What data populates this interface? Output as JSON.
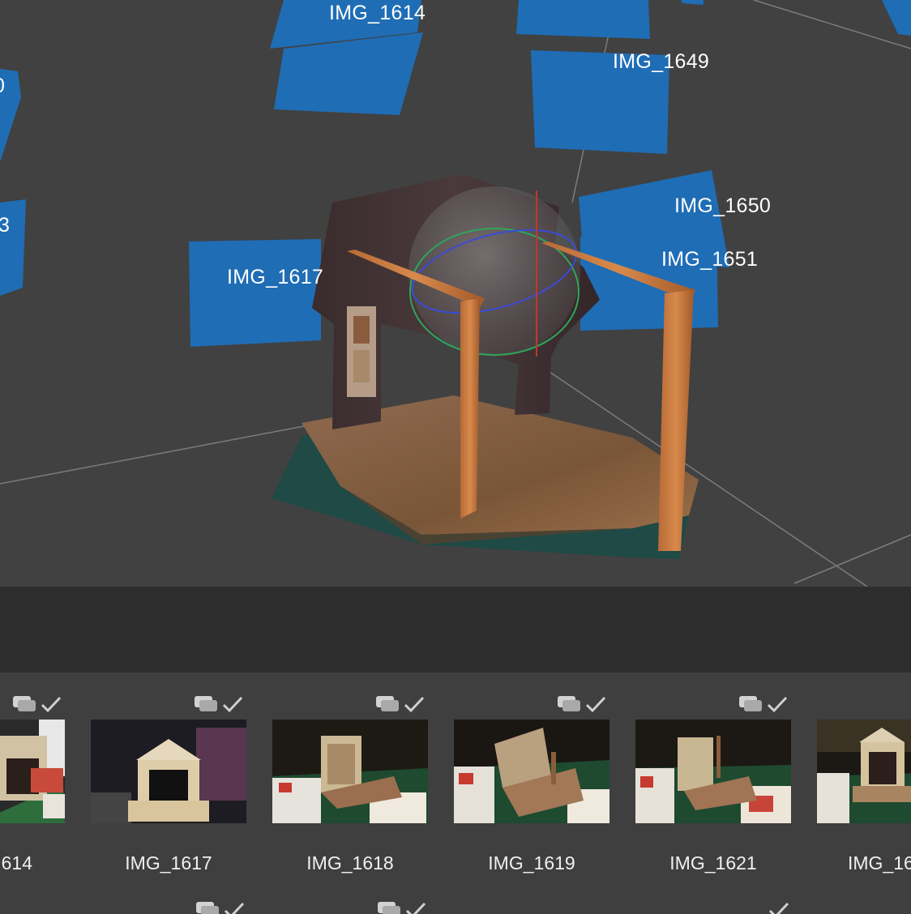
{
  "viewport": {
    "camera_labels": [
      {
        "id": "IMG_1614",
        "text": "IMG_1614"
      },
      {
        "id": "IMG_1649",
        "text": "IMG_1649"
      },
      {
        "id": "IMG_1650",
        "text": "IMG_1650"
      },
      {
        "id": "IMG_1651",
        "text": "IMG_1651"
      },
      {
        "id": "IMG_1617",
        "text": "IMG_1617"
      },
      {
        "id": "left_partial_1",
        "text": "0"
      },
      {
        "id": "left_partial_2",
        "text": "3"
      }
    ],
    "colors": {
      "background": "#414141",
      "camera_frame": "#1f6db5",
      "grid_line": "#8a8a8a"
    }
  },
  "image_strip": {
    "thumbnails": [
      {
        "label": "614",
        "status_icons": [
          "stack-icon",
          "check-icon"
        ]
      },
      {
        "label": "IMG_1617",
        "status_icons": [
          "stack-icon",
          "check-icon"
        ]
      },
      {
        "label": "IMG_1618",
        "status_icons": [
          "stack-icon",
          "check-icon"
        ]
      },
      {
        "label": "IMG_1619",
        "status_icons": [
          "stack-icon",
          "check-icon"
        ]
      },
      {
        "label": "IMG_1621",
        "status_icons": [
          "stack-icon",
          "check-icon"
        ]
      },
      {
        "label": "IMG_16",
        "status_icons": []
      }
    ]
  }
}
